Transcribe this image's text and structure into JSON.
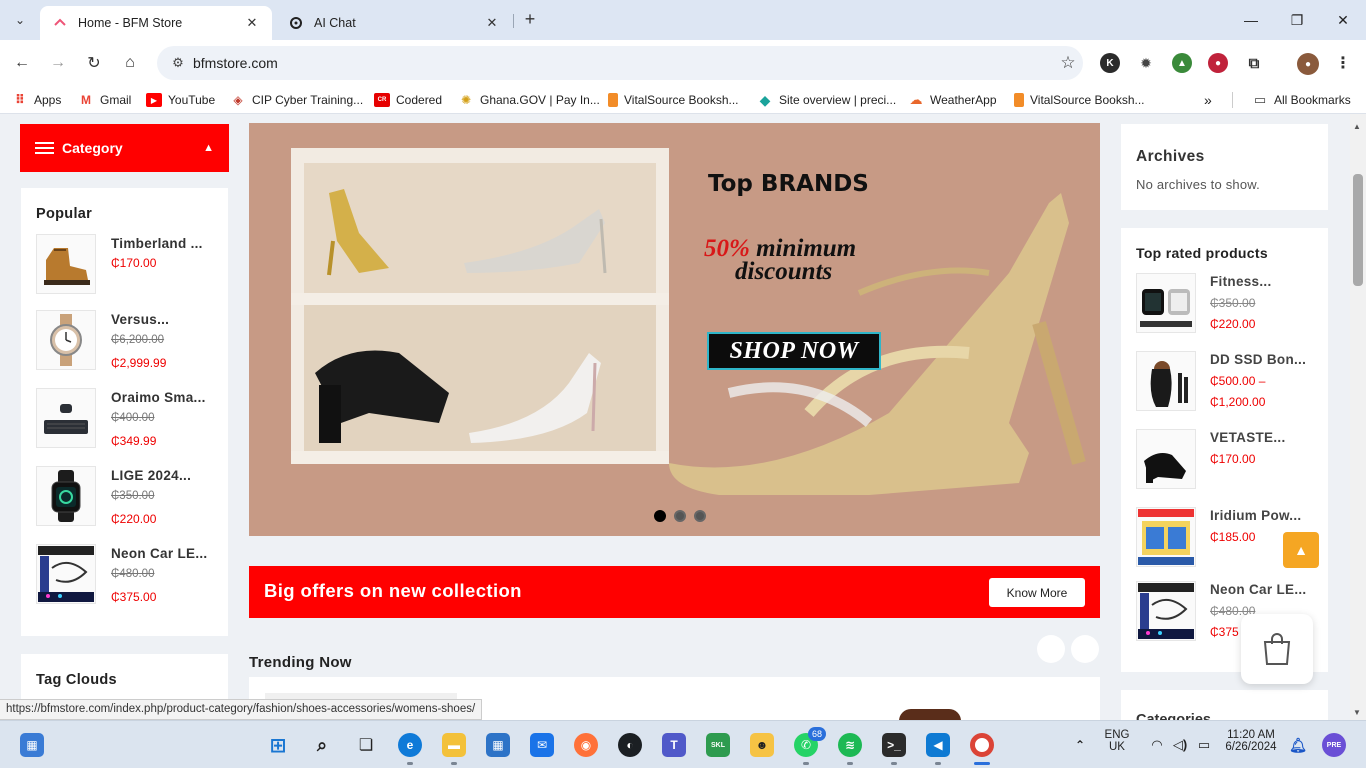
{
  "browser": {
    "tabs": [
      {
        "title": "Home - BFM Store",
        "active": true
      },
      {
        "title": "AI Chat",
        "active": false
      }
    ],
    "url": "bfmstore.com",
    "bookmarks": [
      {
        "label": "Apps",
        "icon": "apps-grid-icon",
        "color": "#ea4335"
      },
      {
        "label": "Gmail",
        "icon": "gmail-icon",
        "color": "#ea4335"
      },
      {
        "label": "YouTube",
        "icon": "youtube-icon",
        "color": "#ff0000"
      },
      {
        "label": "CIP Cyber Training...",
        "icon": "cip-icon",
        "color": "#c0392b"
      },
      {
        "label": "Codered",
        "icon": "codered-icon",
        "color": "#e60000"
      },
      {
        "label": "Ghana.GOV | Pay In...",
        "icon": "ghana-gov-icon",
        "color": "#d4a017"
      },
      {
        "label": "VitalSource Booksh...",
        "icon": "vitalsource-icon",
        "color": "#f28c28"
      },
      {
        "label": "Site overview | preci...",
        "icon": "site-overview-icon",
        "color": "#1aa39b"
      },
      {
        "label": "WeatherApp",
        "icon": "weather-icon",
        "color": "#e8672c"
      },
      {
        "label": "VitalSource Booksh...",
        "icon": "vitalsource-icon",
        "color": "#f28c28"
      }
    ],
    "all_bookmarks": "All Bookmarks",
    "status_url": "https://bfmstore.com/index.php/product-category/fashion/shoes-accessories/womens-shoes/"
  },
  "sidebar": {
    "category_label": "Category",
    "popular_title": "Popular",
    "popular": [
      {
        "name": "Timberland ...",
        "old_price": "",
        "price": "₵170.00"
      },
      {
        "name": "Versus...",
        "old_price": "₵6,200.00",
        "price": "₵2,999.99"
      },
      {
        "name": "Oraimo Sma...",
        "old_price": "₵400.00",
        "price": "₵349.99"
      },
      {
        "name": "LIGE 2024...",
        "old_price": "₵350.00",
        "price": "₵220.00"
      },
      {
        "name": "Neon Car LE...",
        "old_price": "₵480.00",
        "price": "₵375.00"
      }
    ],
    "tag_clouds_title": "Tag Clouds"
  },
  "hero": {
    "title": "Top BRANDS",
    "discount_pct": "50%",
    "discount_rest": "minimum",
    "discount_line2": "discounts",
    "cta": "SHOP NOW",
    "slide_count": 3,
    "active_slide": 1
  },
  "offer": {
    "text": "Big offers on new collection",
    "button": "Know More"
  },
  "trending": {
    "title": "Trending Now"
  },
  "right": {
    "archives_title": "Archives",
    "archives_text": "No archives to show.",
    "top_rated_title": "Top rated products",
    "top_rated": [
      {
        "name": "Fitness...",
        "price1": "₵350.00",
        "price1_strike": true,
        "price2": "₵220.00"
      },
      {
        "name": "DD SSD Bon...",
        "price1": "₵500.00 –",
        "price1_strike": false,
        "price2": "₵1,200.00"
      },
      {
        "name": "VETASTE...",
        "price1": "₵170.00",
        "price1_strike": false,
        "price2": ""
      },
      {
        "name": "Iridium Pow...",
        "price1": "₵185.00",
        "price1_strike": false,
        "price2": ""
      },
      {
        "name": "Neon Car LE...",
        "price1": "₵480.00",
        "price1_strike": true,
        "price2": "₵375"
      }
    ],
    "categories_partial": "Categories"
  },
  "taskbar": {
    "whatsapp_badge": "68",
    "language_line1": "ENG",
    "language_line2": "UK",
    "time": "11:20 AM",
    "date": "6/26/2024"
  },
  "colors": {
    "accent_red": "#ff0000",
    "price_red": "#e00000",
    "scroll_top_orange": "#f5a623"
  }
}
